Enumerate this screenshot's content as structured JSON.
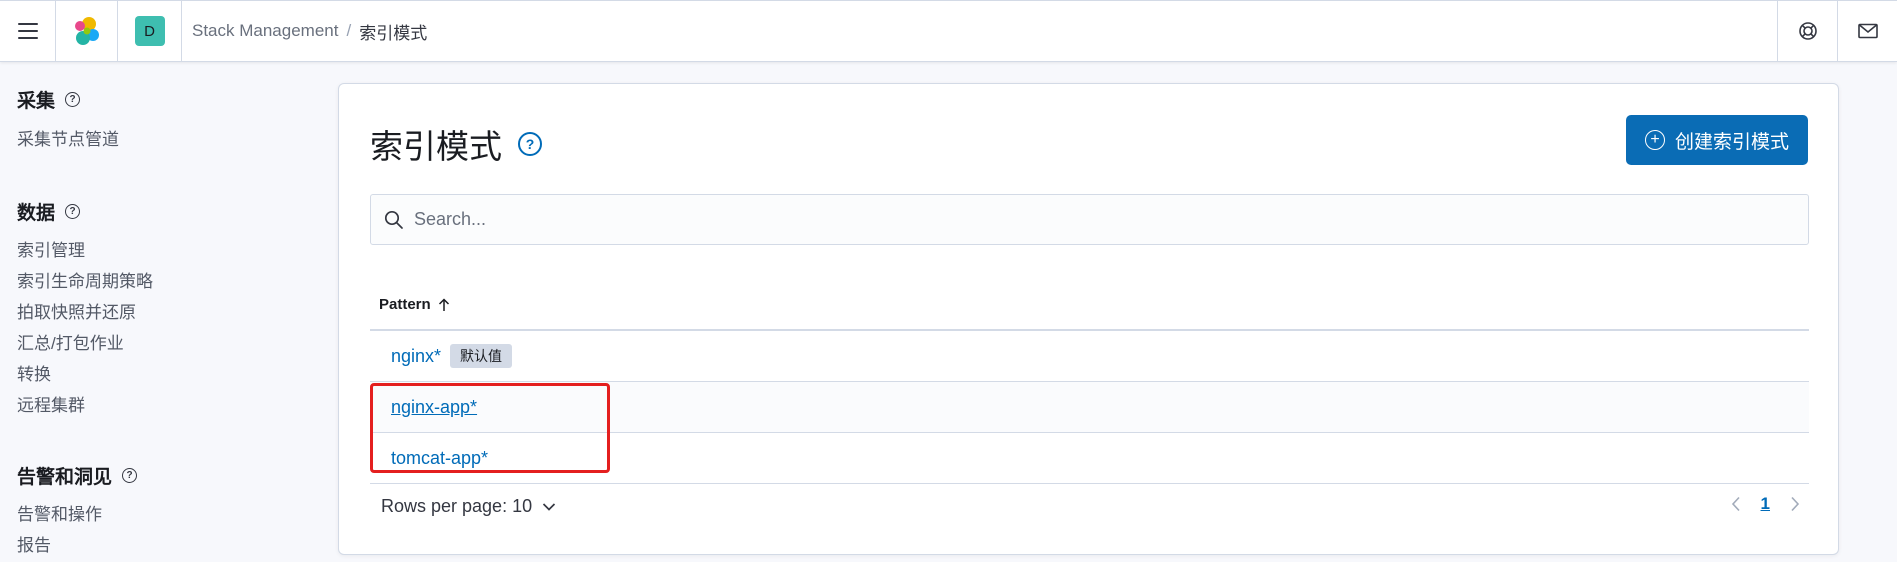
{
  "header": {
    "menu_icon": "hamburger-icon",
    "logo_icon": "elastic-logo-icon",
    "space_initial": "D",
    "space_color": "#3ebeb0",
    "breadcrumbs": [
      {
        "label": "Stack Management"
      },
      {
        "label": "索引模式"
      }
    ],
    "breadcrumb_separator": "/",
    "right_icons": [
      "help-lifebuoy-icon",
      "mail-icon"
    ]
  },
  "sidebar": {
    "groups": [
      {
        "title": "采集",
        "items": [
          "采集节点管道"
        ]
      },
      {
        "title": "数据",
        "items": [
          "索引管理",
          "索引生命周期策略",
          "拍取快照并还原",
          "汇总/打包作业",
          "转换",
          "远程集群"
        ]
      },
      {
        "title": "告警和洞见",
        "items": [
          "告警和操作",
          "报告"
        ]
      }
    ],
    "help_glyph": "?"
  },
  "main": {
    "title": "索引模式",
    "help_glyph": "?",
    "create_button_label": "创建索引模式",
    "search_placeholder": "Search...",
    "table": {
      "column_header": "Pattern",
      "rows": [
        {
          "pattern": "nginx*",
          "badge": "默认值"
        },
        {
          "pattern": "nginx-app*",
          "badge": null
        },
        {
          "pattern": "tomcat-app*",
          "badge": null
        }
      ]
    },
    "rows_per_page_label": "Rows per page: 10",
    "current_page": "1",
    "accent_color": "#0a6cb5",
    "link_color": "#006bb8",
    "highlight_color": "#e41f1f"
  }
}
